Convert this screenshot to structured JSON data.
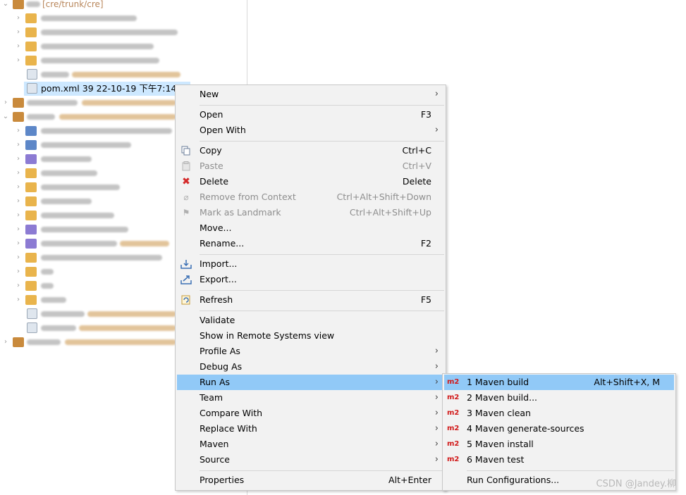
{
  "tree": {
    "root_path": "[cre/trunk/cre]",
    "selected_file": "pom.xml 39  22-10-19 下午7:14"
  },
  "context_menu": {
    "items": [
      {
        "label": "New",
        "accel": "",
        "submenu": true,
        "disabled": false,
        "icon": ""
      },
      {
        "label": "Open",
        "accel": "F3",
        "submenu": false,
        "disabled": false,
        "icon": ""
      },
      {
        "label": "Open With",
        "accel": "",
        "submenu": true,
        "disabled": false,
        "icon": ""
      },
      {
        "label": "Copy",
        "accel": "Ctrl+C",
        "submenu": false,
        "disabled": false,
        "icon": "copy-icon"
      },
      {
        "label": "Paste",
        "accel": "Ctrl+V",
        "submenu": false,
        "disabled": true,
        "icon": "paste-icon"
      },
      {
        "label": "Delete",
        "accel": "Delete",
        "submenu": false,
        "disabled": false,
        "icon": "delete-icon"
      },
      {
        "label": "Remove from Context",
        "accel": "Ctrl+Alt+Shift+Down",
        "submenu": false,
        "disabled": true,
        "icon": "remove-context-icon"
      },
      {
        "label": "Mark as Landmark",
        "accel": "Ctrl+Alt+Shift+Up",
        "submenu": false,
        "disabled": true,
        "icon": "landmark-icon"
      },
      {
        "label": "Move...",
        "accel": "",
        "submenu": false,
        "disabled": false,
        "icon": ""
      },
      {
        "label": "Rename...",
        "accel": "F2",
        "submenu": false,
        "disabled": false,
        "icon": ""
      },
      {
        "label": "Import...",
        "accel": "",
        "submenu": false,
        "disabled": false,
        "icon": "import-icon"
      },
      {
        "label": "Export...",
        "accel": "",
        "submenu": false,
        "disabled": false,
        "icon": "export-icon"
      },
      {
        "label": "Refresh",
        "accel": "F5",
        "submenu": false,
        "disabled": false,
        "icon": "refresh-icon"
      },
      {
        "label": "Validate",
        "accel": "",
        "submenu": false,
        "disabled": false,
        "icon": ""
      },
      {
        "label": "Show in Remote Systems view",
        "accel": "",
        "submenu": false,
        "disabled": false,
        "icon": ""
      },
      {
        "label": "Profile As",
        "accel": "",
        "submenu": true,
        "disabled": false,
        "icon": ""
      },
      {
        "label": "Debug As",
        "accel": "",
        "submenu": true,
        "disabled": false,
        "icon": ""
      },
      {
        "label": "Run As",
        "accel": "",
        "submenu": true,
        "disabled": false,
        "icon": "",
        "highlighted": true
      },
      {
        "label": "Team",
        "accel": "",
        "submenu": true,
        "disabled": false,
        "icon": ""
      },
      {
        "label": "Compare With",
        "accel": "",
        "submenu": true,
        "disabled": false,
        "icon": ""
      },
      {
        "label": "Replace With",
        "accel": "",
        "submenu": true,
        "disabled": false,
        "icon": ""
      },
      {
        "label": "Maven",
        "accel": "",
        "submenu": true,
        "disabled": false,
        "icon": ""
      },
      {
        "label": "Source",
        "accel": "",
        "submenu": true,
        "disabled": false,
        "icon": ""
      },
      {
        "label": "Properties",
        "accel": "Alt+Enter",
        "submenu": false,
        "disabled": false,
        "icon": ""
      }
    ]
  },
  "run_as_submenu": {
    "badge": "m2",
    "items": [
      {
        "label": "1 Maven build",
        "accel": "Alt+Shift+X, M",
        "highlighted": true
      },
      {
        "label": "2 Maven build...",
        "accel": ""
      },
      {
        "label": "3 Maven clean",
        "accel": ""
      },
      {
        "label": "4 Maven generate-sources",
        "accel": ""
      },
      {
        "label": "5 Maven install",
        "accel": ""
      },
      {
        "label": "6 Maven test",
        "accel": ""
      },
      {
        "label": "Run Configurations...",
        "accel": ""
      }
    ]
  },
  "watermark": "CSDN @Jandey.柳",
  "colors": {
    "highlight": "#91c9f7",
    "selection": "#cde8ff",
    "menu_bg": "#f2f2f2",
    "m2_badge": "#d11a1a",
    "delete_icon": "#d42a2a"
  }
}
